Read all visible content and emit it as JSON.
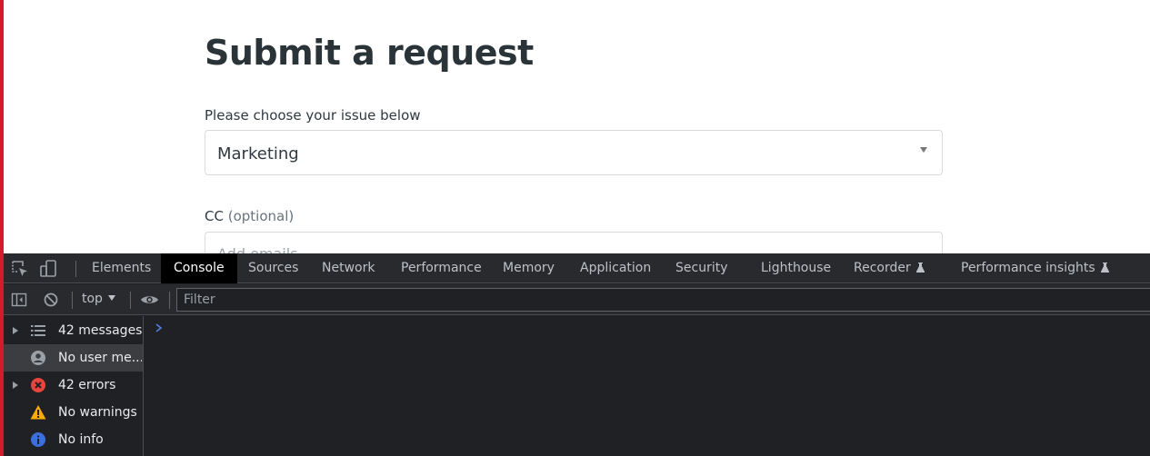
{
  "page": {
    "title": "Submit a request",
    "issue_label": "Please choose your issue below",
    "issue_value": "Marketing",
    "cc_label": "CC",
    "cc_optional": "(optional)",
    "cc_placeholder": "Add emails",
    "accent_color": "#d01c2c"
  },
  "devtools": {
    "tabs": [
      {
        "label": "Elements"
      },
      {
        "label": "Console",
        "active": true
      },
      {
        "label": "Sources"
      },
      {
        "label": "Network"
      },
      {
        "label": "Performance"
      },
      {
        "label": "Memory"
      },
      {
        "label": "Application"
      },
      {
        "label": "Security"
      },
      {
        "label": "Lighthouse"
      },
      {
        "label": "Recorder",
        "experimental": true
      },
      {
        "label": "Performance insights",
        "experimental": true
      }
    ],
    "toolbar": {
      "context": "top",
      "filter_placeholder": "Filter"
    },
    "sidebar": [
      {
        "label": "42 messages",
        "icon": "list-icon",
        "expandable": true
      },
      {
        "label": "No user me...",
        "icon": "user-icon",
        "selected": true
      },
      {
        "label": "42 errors",
        "icon": "error-icon",
        "expandable": true,
        "color": "#e8453c"
      },
      {
        "label": "No warnings",
        "icon": "warning-icon",
        "color": "#f9ab00"
      },
      {
        "label": "No info",
        "icon": "info-icon",
        "color": "#3a6fdc"
      }
    ]
  }
}
